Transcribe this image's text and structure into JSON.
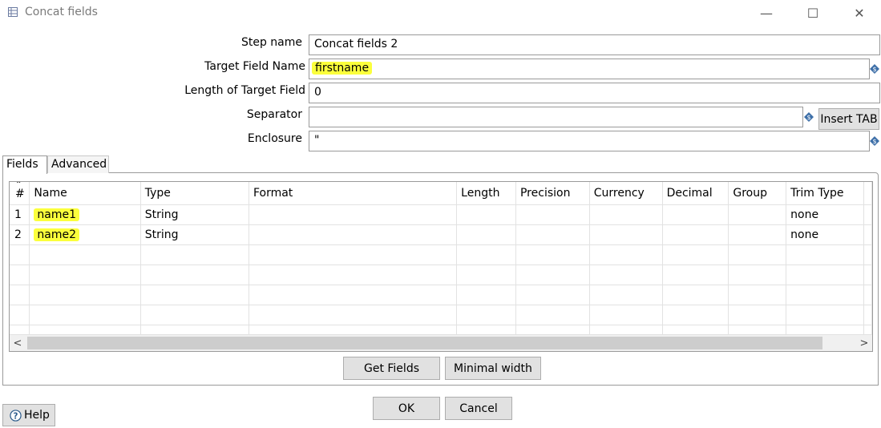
{
  "window": {
    "title": "Concat fields",
    "minimize_glyph": "—",
    "maximize_glyph": "☐",
    "close_glyph": "✕"
  },
  "form": {
    "step_name_label": "Step name",
    "step_name_value": "Concat fields 2",
    "target_field_label": "Target Field Name",
    "target_field_value": "firstname",
    "length_label": "Length of Target Field",
    "length_value": "0",
    "separator_label": "Separator",
    "separator_value": "",
    "insert_tab_label": "Insert TAB",
    "enclosure_label": "Enclosure",
    "enclosure_value": "\""
  },
  "tabs": [
    {
      "label": "Fields",
      "active": true
    },
    {
      "label": "Advanced",
      "active": false
    }
  ],
  "table": {
    "columns": [
      "#",
      "Name",
      "Type",
      "Format",
      "Length",
      "Precision",
      "Currency",
      "Decimal",
      "Group",
      "Trim Type"
    ],
    "rows": [
      {
        "num": "1",
        "name": "name1",
        "type": "String",
        "format": "",
        "length": "",
        "precision": "",
        "currency": "",
        "decimal": "",
        "group": "",
        "trim": "none"
      },
      {
        "num": "2",
        "name": "name2",
        "type": "String",
        "format": "",
        "length": "",
        "precision": "",
        "currency": "",
        "decimal": "",
        "group": "",
        "trim": "none"
      }
    ],
    "scroll_left": "<",
    "scroll_right": ">"
  },
  "buttons": {
    "get_fields": "Get Fields",
    "minimal_width": "Minimal width",
    "ok": "OK",
    "cancel": "Cancel",
    "help": "Help"
  },
  "colors": {
    "highlight": "#fbff3c",
    "variable_icon": "#3d6fa8"
  },
  "sort_glyph": "⌃"
}
